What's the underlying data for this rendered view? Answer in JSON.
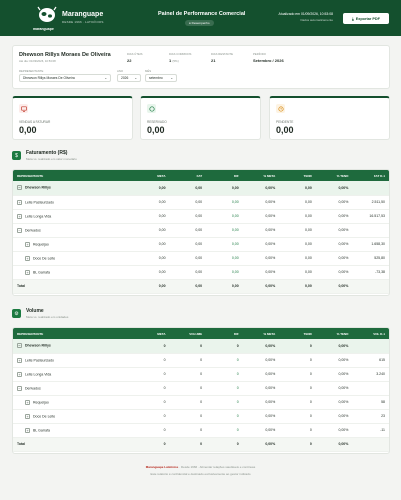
{
  "header": {
    "brand_name": "Maranguape",
    "brand_tagline": "DESDE 1966 · LATICÍNIOS",
    "logo_text": "maranguape",
    "title": "Painel de Performance Comercial",
    "badge": "Desempenho",
    "updated": "Atualizado em 01/09/2026, 10:53:08",
    "updated_sub": "Dados automaticamente",
    "export_label": "Exportar PDF"
  },
  "info": {
    "name": "Dhewson Rillys Moraes De Oliveira",
    "date": "Até dia: 01/09/2026, 10:53:08",
    "dias_uteis_label": "DIAS ÚTEIS",
    "dias_uteis": "22",
    "dias_corridos_label": "DIAS CORRIDOS",
    "dias_corridos": "1",
    "dias_corridos_pct": "(5%)",
    "dias_restantes_label": "DIAS RESTANTE",
    "dias_restantes": "21",
    "periodo_label": "PERÍODO",
    "periodo": "Setembro / 2026",
    "rep_label": "REPRESENTANTE",
    "rep_value": "Dhewson Rillys Moraes De Oliveira",
    "ano_label": "ANO",
    "ano_value": "2026",
    "mes_label": "MÊS",
    "mes_value": "setembro"
  },
  "kpis": [
    {
      "label": "VENDAS A FATURAR",
      "value": "0,00",
      "color": "#c0392b",
      "icon": "monitor-icon"
    },
    {
      "label": "RESERVADO",
      "value": "0,00",
      "color": "#1b7a41",
      "icon": "circle-icon"
    },
    {
      "label": "PENDENTE",
      "value": "0,00",
      "color": "#d68910",
      "icon": "clock-icon"
    }
  ],
  "faturamento": {
    "icon": "$",
    "title": "Faturamento (R$)",
    "subtitle": "Meta vs. realizado em valor monetário",
    "columns": [
      "REPRESENTANTE",
      "META",
      "FAT",
      "DIF",
      "% META",
      "TEND",
      "% TEND",
      "FAT D-1"
    ],
    "rows": [
      {
        "type": "grp",
        "toggle": "−",
        "cells": [
          "Dhewson Rillys",
          "0,00",
          "0,00",
          "0,00",
          "0,00%",
          "0,00",
          "0,00%",
          ""
        ]
      },
      {
        "type": "l1",
        "toggle": "+",
        "cells": [
          "Leite Pasteurizado",
          "0,00",
          "0,00",
          "0,00",
          "0,00%",
          "0,00",
          "0,00%",
          "2.511,50"
        ]
      },
      {
        "type": "l1",
        "toggle": "+",
        "cells": [
          "Leite Longa Vida",
          "0,00",
          "0,00",
          "0,00",
          "0,00%",
          "0,00",
          "0,00%",
          "16.517,53"
        ]
      },
      {
        "type": "l1",
        "toggle": "−",
        "cells": [
          "Derivados",
          "0,00",
          "0,00",
          "0,00",
          "0,00%",
          "0,00",
          "0,00%",
          ""
        ]
      },
      {
        "type": "l2",
        "toggle": "+",
        "cells": [
          "Requeijao",
          "0,00",
          "0,00",
          "0,00",
          "0,00%",
          "0,00",
          "0,00%",
          "1.658,30"
        ]
      },
      {
        "type": "l2",
        "toggle": "+",
        "cells": [
          "Doce De Leite",
          "0,00",
          "0,00",
          "0,00",
          "0,00%",
          "0,00",
          "0,00%",
          "525,80"
        ]
      },
      {
        "type": "l2",
        "toggle": "+",
        "cells": [
          "BL Garrafa",
          "0,00",
          "0,00",
          "0,00",
          "0,00%",
          "0,00",
          "0,00%",
          "-73,38"
        ]
      },
      {
        "type": "tot",
        "toggle": "",
        "cells": [
          "Total",
          "0,00",
          "0,00",
          "0,00",
          "0,00%",
          "0,00",
          "0,00%",
          ""
        ]
      }
    ]
  },
  "volume": {
    "icon": "⚙",
    "title": "Volume",
    "subtitle": "Meta vs. realizado em unidades",
    "columns": [
      "REPRESENTANTE",
      "META",
      "VOLUME",
      "DIF",
      "% META",
      "TEND",
      "% TEND",
      "VOL D-1"
    ],
    "rows": [
      {
        "type": "grp",
        "toggle": "−",
        "cells": [
          "Dhewson Rillys",
          "0",
          "0",
          "0",
          "0,00%",
          "0",
          "0,00%",
          ""
        ]
      },
      {
        "type": "l1",
        "toggle": "+",
        "cells": [
          "Leite Pasteurizado",
          "0",
          "0",
          "0",
          "0,00%",
          "0",
          "0,00%",
          "615"
        ]
      },
      {
        "type": "l1",
        "toggle": "+",
        "cells": [
          "Leite Longa Vida",
          "0",
          "0",
          "0",
          "0,00%",
          "0",
          "0,00%",
          "3.240"
        ]
      },
      {
        "type": "l1",
        "toggle": "−",
        "cells": [
          "Derivados",
          "0",
          "0",
          "0",
          "0,00%",
          "0",
          "0,00%",
          ""
        ]
      },
      {
        "type": "l2",
        "toggle": "+",
        "cells": [
          "Requeijao",
          "0",
          "0",
          "0",
          "0,00%",
          "0",
          "0,00%",
          "58"
        ]
      },
      {
        "type": "l2",
        "toggle": "+",
        "cells": [
          "Doce De Leite",
          "0",
          "0",
          "0",
          "0,00%",
          "0",
          "0,00%",
          "23"
        ]
      },
      {
        "type": "l2",
        "toggle": "+",
        "cells": [
          "BL Garrafa",
          "0",
          "0",
          "0",
          "0,00%",
          "0",
          "0,00%",
          "-11"
        ]
      },
      {
        "type": "tot",
        "toggle": "",
        "cells": [
          "Total",
          "0",
          "0",
          "0",
          "0,00%",
          "0",
          "0,00%",
          ""
        ]
      }
    ]
  },
  "footer": {
    "brand": "Maranguape Laticínios",
    "line1": "· Desde 1966 · Alimentar relações saudáveis e contínuas",
    "line2": "Este relatório é confidencial e destinado exclusivamente ao gestor indicado"
  }
}
